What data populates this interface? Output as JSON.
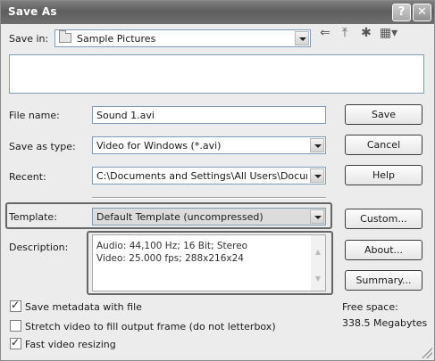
{
  "window": {
    "title": "Save As"
  },
  "titlebar": {
    "help_label": "?",
    "close_label": "✕"
  },
  "save_in": {
    "label": "Save in:",
    "value": "Sample Pictures"
  },
  "toolbar": {
    "back_icon": "⇐",
    "up_icon": "⤒",
    "new_folder_icon": "✱",
    "views_icon": "▦▾"
  },
  "form": {
    "file_name_label": "File name:",
    "file_name_value": "Sound 1.avi",
    "save_as_type_label": "Save as type:",
    "save_as_type_value": "Video for Windows (*.avi)",
    "recent_label": "Recent:",
    "recent_value": "C:\\Documents and Settings\\All Users\\Docum",
    "template_label": "Template:",
    "template_value": "Default Template (uncompressed)",
    "description_label": "Description:",
    "description_lines": [
      "Audio: 44,100 Hz; 16 Bit; Stereo",
      "Video: 25.000 fps; 288x216x24"
    ]
  },
  "buttons": {
    "save": "Save",
    "cancel": "Cancel",
    "help": "Help",
    "custom": "Custom...",
    "about": "About...",
    "summary": "Summary..."
  },
  "options": [
    {
      "label": "Save metadata with file",
      "checked": true
    },
    {
      "label": "Stretch video to fill output frame (do not letterbox)",
      "checked": false
    },
    {
      "label": "Fast video resizing",
      "checked": true
    }
  ],
  "free_space": {
    "label": "Free space:",
    "value": "338.5 Megabytes"
  },
  "colors": {
    "highlight": "#dcdcdc",
    "highlight_border": "#666666"
  }
}
